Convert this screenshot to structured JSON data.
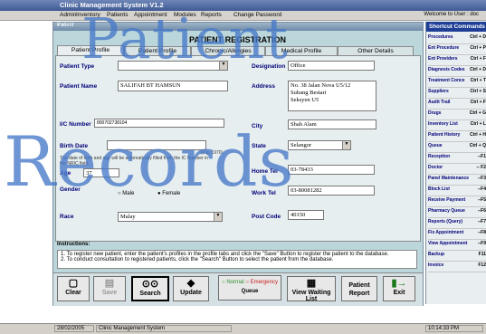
{
  "app": {
    "title": "Clinic Management System V1.2",
    "welcome": "Welcome to User : doc"
  },
  "menu": [
    "Admin",
    "Inventory",
    "Patients",
    "Appointment",
    "Modules",
    "Reports",
    "Change Password"
  ],
  "window": {
    "title": "Patient",
    "heading": "PATIENT REGISTRATION"
  },
  "tabs": [
    "Patient Profile",
    "Patient Profile",
    "Chronic/Allergies",
    "Medical Profile",
    "Other Details"
  ],
  "form": {
    "patient_type_label": "Patient Type",
    "designation_label": "Designation",
    "designation_value": "Office",
    "patient_name_label": "Patient Name",
    "patient_name_value": "SALIFAH BT HAMSUN",
    "address_label": "Address",
    "address_lines": [
      "No. 38 Jalan Nova U5/12",
      "Subang Bestari",
      "Seksyen U5"
    ],
    "ic_label": "I/C Number",
    "ic_value": "800702738104",
    "city_label": "City",
    "city_value": "Shah Alam",
    "birth_date_label": "Birth Date",
    "birth_note": "(e.g. 1970)",
    "state_label": "State",
    "state_value": "Selangor",
    "ic_hint": "The date of birth and age will be automatically filled from the IC Number in the NRIC field.",
    "age_label": "Age",
    "age_value": "37",
    "home_tel_label": "Home Tel",
    "home_tel_value": "03-78433",
    "gender_label": "Gender",
    "gender_options": [
      "Male",
      "Female"
    ],
    "work_tel_label": "Work Tel",
    "work_tel_value": "03-80081282",
    "race_label": "Race",
    "race_value": "Malay",
    "post_code_label": "Post Code",
    "post_code_value": "40150"
  },
  "instructions": {
    "title": "Instructions:",
    "lines": [
      "1. To register new patient, enter the patient's profiles in the profile tabs and click the \"Save\" Button to register the patient to the database.",
      "2. To conduct consultation to registered patients, click the \"Search\" Button to select the patient from the database."
    ]
  },
  "toolbar": {
    "clear": "Clear",
    "save": "Save",
    "search": "Search",
    "update": "Update",
    "queue_normal": "Normal",
    "queue_emergency": "Emergency",
    "queue_label": "Queue",
    "view_waiting": "View Waiting List",
    "patient_report": "Patient Report",
    "exit": "Exit"
  },
  "shortcuts": {
    "title": "Shortcut Commands",
    "items": [
      {
        "name": "Procedures",
        "key": "Ctrl + D"
      },
      {
        "name": "Ent Procedure",
        "key": "Ctrl + P"
      },
      {
        "name": "Ent Providers",
        "key": "Ctrl + F"
      },
      {
        "name": "Diagnosis Codes",
        "key": "Ctrl + D"
      },
      {
        "name": "Treatment Conce",
        "key": "Ctrl + T"
      },
      {
        "name": "Suppliers",
        "key": "Ctrl + S"
      },
      {
        "name": "Audit Trail",
        "key": "Ctrl + F"
      },
      {
        "name": "Drugs",
        "key": "Ctrl + G"
      },
      {
        "name": "Inventory List",
        "key": "Ctrl + L"
      },
      {
        "name": "Patient History",
        "key": "Ctrl + H"
      },
      {
        "name": "Queue",
        "key": "Ctrl + Q"
      },
      {
        "name": "Reception",
        "key": "--F1"
      },
      {
        "name": "Doctor",
        "key": "-- F2"
      },
      {
        "name": "Panel Maintenance",
        "key": "--F3"
      },
      {
        "name": "Block List",
        "key": "--F4"
      },
      {
        "name": "Receive Payment",
        "key": "--F5"
      },
      {
        "name": "Pharmacy Queue",
        "key": "--F6"
      },
      {
        "name": "Reports (Query)",
        "key": "--F7"
      },
      {
        "name": "Fix Appointment",
        "key": "--F8"
      },
      {
        "name": "View Appointment",
        "key": "--F9"
      },
      {
        "name": "Backup",
        "key": "F11"
      },
      {
        "name": "Invoice",
        "key": "F12"
      }
    ]
  },
  "status": {
    "date": "28/02/2005",
    "app": "Clinic Management System",
    "time": "10:14:33 PM"
  },
  "watermark": {
    "line1": "Patient",
    "line2": "Records"
  }
}
